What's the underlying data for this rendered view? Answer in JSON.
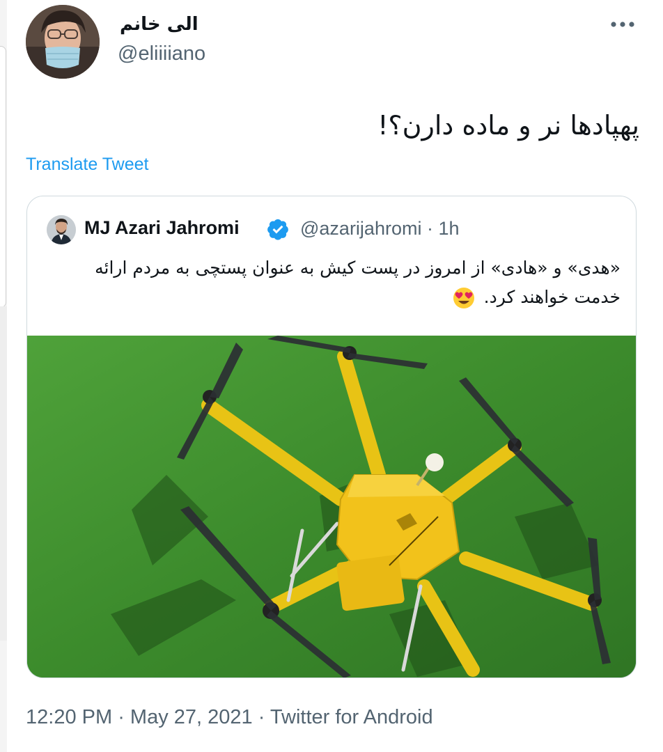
{
  "author": {
    "display_name": "الی خانم",
    "handle": "@eliiiiano"
  },
  "tweet": {
    "text": "پهپادها نر و ماده دارن؟!",
    "translate_label": "Translate Tweet"
  },
  "quoted_tweet": {
    "name": "MJ Azari Jahromi",
    "handle_time": "@azarijahromi · 1h",
    "text": "«هدی» و «هادی» از امروز در پست کیش به عنوان پستچی به مردم ارائه خدمت خواهند کرد.",
    "emoji": "smiling-face-with-heart-eyes"
  },
  "meta": {
    "time": "12:20 PM",
    "sep1": " · ",
    "date": "May 27, 2021",
    "sep2": " · ",
    "source": "Twitter for Android"
  },
  "colors": {
    "link": "#1d9bf0",
    "secondary_text": "#536471",
    "border": "#cfd9de",
    "drone_yellow": "#f2c21b",
    "grass": "#3e8a2e"
  }
}
